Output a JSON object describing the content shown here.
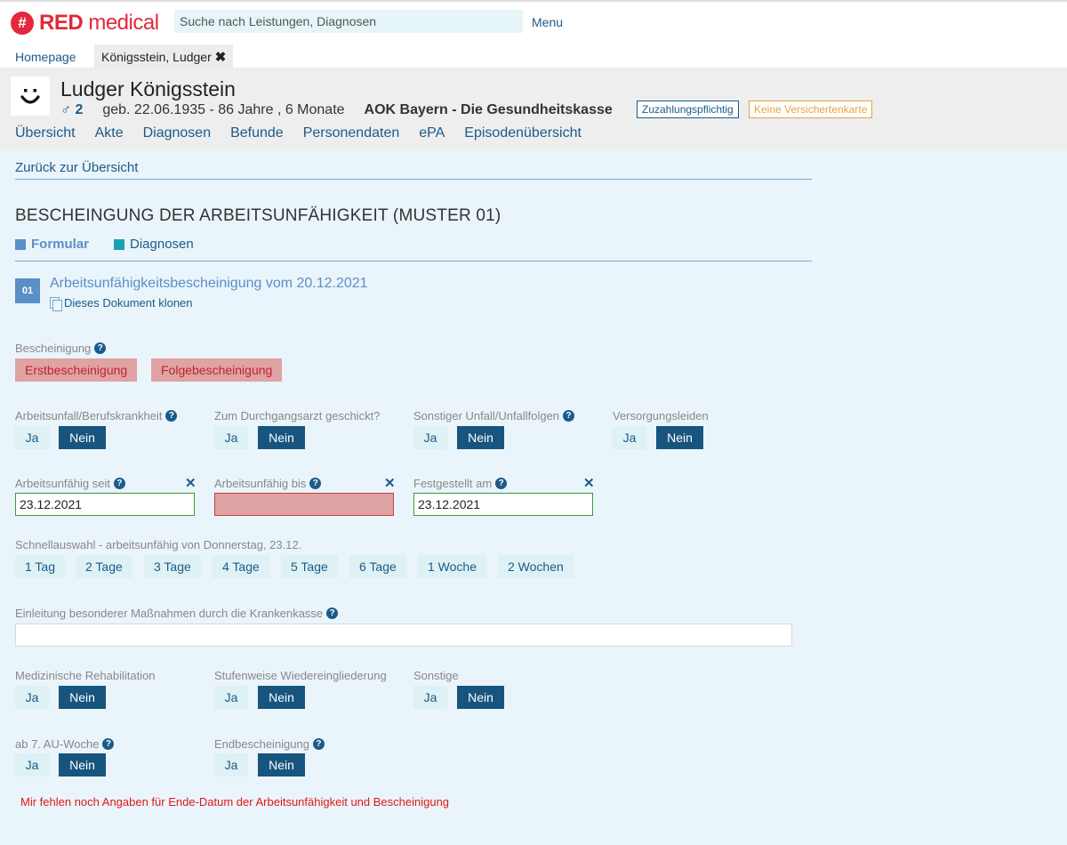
{
  "app": {
    "logo_symbol": "#",
    "logo_bold": "RED",
    "logo_rest": " medical",
    "search_placeholder": "Suche nach Leistungen, Diagnosen",
    "menu_label": "Menu",
    "brand_color": "#e2283a"
  },
  "tabs": {
    "home": "Homepage",
    "patient": "Königsstein, Ludger",
    "close": "✖"
  },
  "patient": {
    "avatar": "smiley-face",
    "name": "Ludger Königsstein",
    "gender": "♂ 2",
    "birth": "geb. 22.06.1935 - 86 Jahre , 6 Monate",
    "insurer": "AOK Bayern - Die Gesundheitskasse",
    "badge_copay": "Zuzahlungspflichtig",
    "badge_card": "Keine Versichertenkarte",
    "nav": [
      "Übersicht",
      "Akte",
      "Diagnosen",
      "Befunde",
      "Personendaten",
      "ePA",
      "Episodenübersicht"
    ]
  },
  "form": {
    "back": "Zurück zur Übersicht",
    "title": "BESCHEINGUNG DER ARBEITSUNFÄHIGKEIT (MUSTER 01)",
    "tab_formular": "Formular",
    "tab_diagnosen": "Diagnosen",
    "doc_number": "01",
    "doc_title": "Arbeitsunfähigkeitsbescheinigung vom 20.12.2021",
    "clone_label": "Dieses Dokument klonen",
    "bescheinigung_label": "Bescheinigung",
    "erst": "Erstbescheinigung",
    "folge": "Folgebescheinigung",
    "ja": "Ja",
    "nein": "Nein",
    "q_arbeitsunfall": "Arbeitsunfall/Berufskrankheit",
    "q_durchgangsarzt": "Zum Durchgangsarzt geschickt?",
    "q_sonstiger_unfall": "Sonstiger Unfall/Unfallfolgen",
    "q_versorgung": "Versorgungsleiden",
    "au_seit_label": "Arbeitsunfähig seit",
    "au_seit_value": "23.12.2021",
    "au_bis_label": "Arbeitsunfähig bis",
    "au_bis_value": "",
    "festgestellt_label": "Festgestellt am",
    "festgestellt_value": "23.12.2021",
    "clear": "✕",
    "help": "?",
    "schnell_label": "Schnellauswahl - arbeitsunfähig von Donnerstag, 23.12.",
    "schnell": [
      "1 Tag",
      "2 Tage",
      "3 Tage",
      "4 Tage",
      "5 Tage",
      "6 Tage",
      "1 Woche",
      "2 Wochen"
    ],
    "krankenkasse_label": "Einleitung besonderer Maßnahmen durch die Krankenkasse",
    "q_reha": "Medizinische Rehabilitation",
    "q_wiedereingliederung": "Stufenweise Wiedereingliederung",
    "q_sonstige": "Sonstige",
    "q_au_woche": "ab 7. AU-Woche",
    "q_endbescheinigung": "Endbescheinigung",
    "error": "Mir fehlen noch Angaben für Ende-Datum der Arbeitsunfähigkeit und Bescheinigung"
  }
}
